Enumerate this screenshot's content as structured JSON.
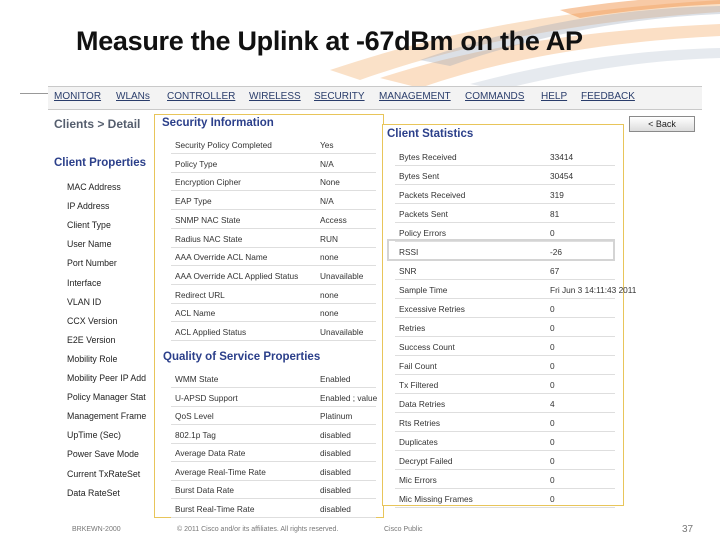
{
  "slide": {
    "title": "Measure the Uplink at -67dBm on the AP"
  },
  "nav": {
    "items": [
      {
        "label": "MONITOR"
      },
      {
        "label": "WLANs"
      },
      {
        "label": "CONTROLLER"
      },
      {
        "label": "WIRELESS"
      },
      {
        "label": "SECURITY"
      },
      {
        "label": "MANAGEMENT"
      },
      {
        "label": "COMMANDS"
      },
      {
        "label": "HELP"
      },
      {
        "label": "FEEDBACK"
      }
    ]
  },
  "page": {
    "breadcrumb": "Clients > Detail",
    "back_label": "< Back"
  },
  "client_properties": {
    "heading": "Client Properties",
    "fields": [
      "MAC Address",
      "IP Address",
      "Client Type",
      "User Name",
      "Port Number",
      "Interface",
      "VLAN ID",
      "CCX Version",
      "E2E Version",
      "Mobility Role",
      "Mobility Peer IP Add",
      "Policy Manager Stat",
      "Management Frame",
      "UpTime (Sec)",
      "Power Save Mode",
      "Current TxRateSet",
      "Data RateSet"
    ]
  },
  "security_information": {
    "heading": "Security Information",
    "rows": [
      {
        "label": "Security Policy Completed",
        "value": "Yes"
      },
      {
        "label": "Policy Type",
        "value": "N/A"
      },
      {
        "label": "Encryption Cipher",
        "value": "None"
      },
      {
        "label": "EAP Type",
        "value": "N/A"
      },
      {
        "label": "SNMP NAC State",
        "value": "Access"
      },
      {
        "label": "Radius NAC State",
        "value": "RUN"
      },
      {
        "label": "AAA Override ACL Name",
        "value": "none"
      },
      {
        "label": "AAA Override ACL Applied Status",
        "value": "Unavailable"
      },
      {
        "label": "Redirect URL",
        "value": "none"
      },
      {
        "label": "ACL Name",
        "value": "none"
      },
      {
        "label": "ACL Applied Status",
        "value": "Unavailable"
      }
    ]
  },
  "qos_properties": {
    "heading": "Quality of Service Properties",
    "rows": [
      {
        "label": "WMM State",
        "value": "Enabled"
      },
      {
        "label": "U-APSD Support",
        "value": "Enabled ; value"
      },
      {
        "label": "QoS Level",
        "value": "Platinum"
      },
      {
        "label": "802.1p Tag",
        "value": "disabled"
      },
      {
        "label": "Average Data Rate",
        "value": "disabled"
      },
      {
        "label": "Average Real-Time Rate",
        "value": "disabled"
      },
      {
        "label": "Burst Data Rate",
        "value": "disabled"
      },
      {
        "label": "Burst Real-Time Rate",
        "value": "disabled"
      }
    ]
  },
  "client_statistics": {
    "heading": "Client Statistics",
    "rows": [
      {
        "label": "Bytes Received",
        "value": "33414"
      },
      {
        "label": "Bytes Sent",
        "value": "30454"
      },
      {
        "label": "Packets Received",
        "value": "319"
      },
      {
        "label": "Packets Sent",
        "value": "81"
      },
      {
        "label": "Policy Errors",
        "value": "0"
      },
      {
        "label": "RSSI",
        "value": "-26"
      },
      {
        "label": "SNR",
        "value": "67"
      },
      {
        "label": "Sample Time",
        "value": "Fri Jun  3 14:11:43 2011"
      },
      {
        "label": "Excessive Retries",
        "value": "0"
      },
      {
        "label": "Retries",
        "value": "0"
      },
      {
        "label": "Success Count",
        "value": "0"
      },
      {
        "label": "Fail Count",
        "value": "0"
      },
      {
        "label": "Tx Filtered",
        "value": "0"
      },
      {
        "label": "Data Retries",
        "value": "4"
      },
      {
        "label": "Rts Retries",
        "value": "0"
      },
      {
        "label": "Duplicates",
        "value": "0"
      },
      {
        "label": "Decrypt Failed",
        "value": "0"
      },
      {
        "label": "Mic Errors",
        "value": "0"
      },
      {
        "label": "Mic Missing Frames",
        "value": "0"
      }
    ]
  },
  "footer": {
    "session": "BRKEWN-2000",
    "copyright": "© 2011 Cisco and/or its affiliates. All rights reserved.",
    "classification": "Cisco Public",
    "page_number": "37"
  },
  "colors": {
    "heading_blue": "#2b3f8a",
    "panel_border": "#e8c55a",
    "swoosh_orange": "#f3a35a"
  }
}
